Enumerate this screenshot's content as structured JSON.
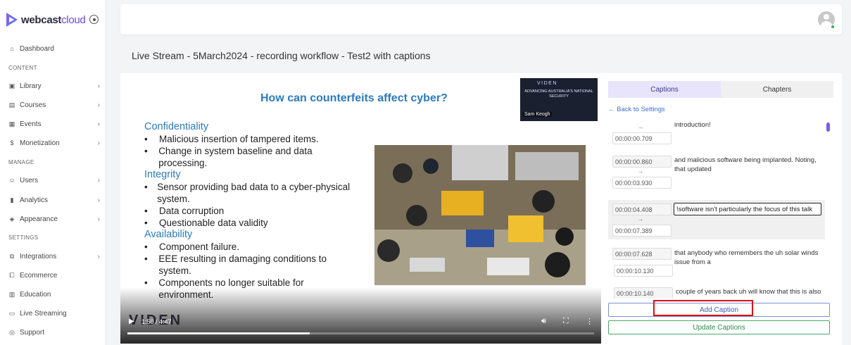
{
  "brand": {
    "name_main": "webcast",
    "name_accent": "cloud",
    "accent_color": "#6b4bd6"
  },
  "sidebar": {
    "dashboard": "Dashboard",
    "sections": {
      "content": "CONTENT",
      "manage": "MANAGE",
      "settings": "SETTINGS"
    },
    "items": [
      {
        "label": "Library",
        "icon": "library-icon"
      },
      {
        "label": "Courses",
        "icon": "courses-icon"
      },
      {
        "label": "Events",
        "icon": "calendar-icon"
      },
      {
        "label": "Monetization",
        "icon": "dollar-icon"
      },
      {
        "label": "Users",
        "icon": "users-icon"
      },
      {
        "label": "Analytics",
        "icon": "analytics-icon"
      },
      {
        "label": "Appearance",
        "icon": "appearance-icon"
      },
      {
        "label": "Integrations",
        "icon": "integrations-icon"
      },
      {
        "label": "Ecommerce",
        "icon": "ecommerce-icon"
      },
      {
        "label": "Education",
        "icon": "book-icon"
      },
      {
        "label": "Live Streaming",
        "icon": "live-icon"
      },
      {
        "label": "Support",
        "icon": "support-icon"
      }
    ]
  },
  "page": {
    "title": "Live Stream - 5March2024 - recording workflow - Test2 with captions"
  },
  "video": {
    "slide_title": "How can counterfeits affect cyber?",
    "camera": {
      "brand": "VIDEN",
      "tagline": "ADVANCING AUSTRALIA'S NATIONAL SECURITY",
      "speaker": "Sam Keogh"
    },
    "sections": [
      {
        "heading": "Confidentiality",
        "bullets": [
          "Malicious insertion of tampered items.",
          "Change in system baseline and data processing."
        ]
      },
      {
        "heading": "Integrity",
        "bullets": [
          "Sensor providing bad data to a cyber-physical system.",
          "Data corruption",
          "Questionable data validity"
        ]
      },
      {
        "heading": "Availability",
        "bullets": [
          "Component failure.",
          "EEE resulting in damaging conditions to system.",
          "Components no longer suitable for environment."
        ]
      }
    ],
    "watermark": "VIDEN",
    "time": "1:50 / 4:47",
    "progress": 0.39
  },
  "panel": {
    "tabs": {
      "captions": "Captions",
      "chapters": "Chapters"
    },
    "back_link": "← Back to Settings",
    "arrow": "→",
    "captions": [
      {
        "start": "",
        "end": "00:00:00.709",
        "text": "introduction!"
      },
      {
        "start": "00:00:00.860",
        "end": "00:00:03.930",
        "text": "and malicious software being implanted. Noting, that updated"
      },
      {
        "start": "00:00:04.408",
        "end": "00:00:07.389",
        "text": "software isn't particularly the focus of this talk!"
      },
      {
        "start": "00:00:07.628",
        "end": "00:00:10.130",
        "text": "that anybody who remembers the uh solar winds issue from a"
      },
      {
        "start": "00:00:10.140",
        "end": "",
        "text": "couple of years back uh will know that this is also"
      }
    ],
    "add_caption": "Add Caption",
    "update_captions": "Update Captions"
  }
}
